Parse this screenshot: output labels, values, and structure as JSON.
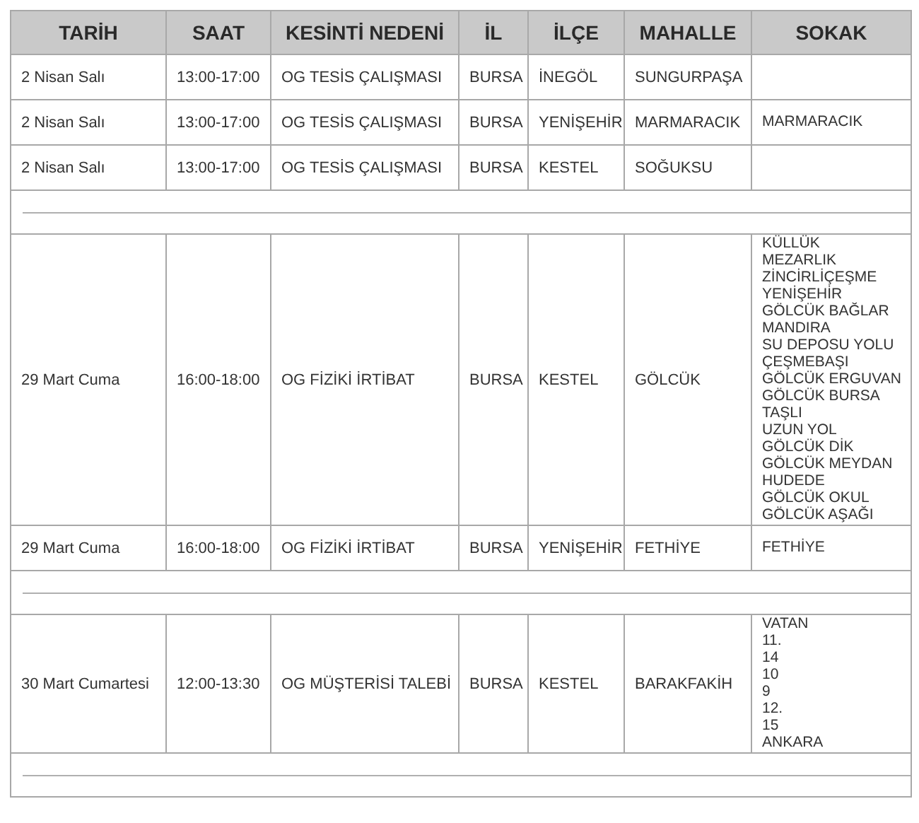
{
  "table": {
    "columns": [
      "TARİH",
      "SAAT",
      "KESİNTİ NEDENİ",
      "İL",
      "İLÇE",
      "MAHALLE",
      "SOKAK"
    ],
    "rows": [
      {
        "kind": "data",
        "cells": [
          "2 Nisan Salı",
          "13:00-17:00",
          "OG TESİS ÇALIŞMASI",
          "BURSA",
          "İNEGÖL",
          "SUNGURPAŞA"
        ],
        "streets": []
      },
      {
        "kind": "data",
        "cells": [
          "2 Nisan Salı",
          "13:00-17:00",
          "OG TESİS ÇALIŞMASI",
          "BURSA",
          "YENİŞEHİR",
          "MARMARACIK"
        ],
        "streets": [
          "MARMARACIK"
        ]
      },
      {
        "kind": "data",
        "cells": [
          "2 Nisan Salı",
          "13:00-17:00",
          "OG TESİS ÇALIŞMASI",
          "BURSA",
          "KESTEL",
          "SOĞUKSU"
        ],
        "streets": []
      },
      {
        "kind": "separator"
      },
      {
        "kind": "data",
        "cells": [
          "29 Mart Cuma",
          "16:00-18:00",
          "OG FİZİKİ İRTİBAT",
          "BURSA",
          "KESTEL",
          "GÖLCÜK"
        ],
        "streets": [
          "KÜLLÜK",
          "MEZARLIK",
          "ZİNCİRLİÇEŞME",
          "YENİŞEHİR",
          "GÖLCÜK BAĞLAR",
          "MANDIRA",
          "SU DEPOSU YOLU",
          "ÇEŞMEBAŞI",
          "GÖLCÜK ERGUVAN",
          "GÖLCÜK BURSA",
          "TAŞLI",
          "UZUN YOL",
          "GÖLCÜK DİK",
          "GÖLCÜK MEYDAN",
          "HUDEDE",
          "GÖLCÜK OKUL",
          "GÖLCÜK AŞAĞI"
        ]
      },
      {
        "kind": "data",
        "cells": [
          "29 Mart Cuma",
          "16:00-18:00",
          "OG FİZİKİ İRTİBAT",
          "BURSA",
          "YENİŞEHİR",
          "FETHİYE"
        ],
        "streets": [
          "FETHİYE"
        ]
      },
      {
        "kind": "separator"
      },
      {
        "kind": "data",
        "cells": [
          "30 Mart Cumartesi",
          "12:00-13:30",
          "OG MÜŞTERİSİ TALEBİ",
          "BURSA",
          "KESTEL",
          "BARAKFAKİH"
        ],
        "streets": [
          "VATAN",
          "11.",
          "14",
          "10",
          "9",
          "12.",
          "15",
          "ANKARA"
        ]
      },
      {
        "kind": "separator"
      }
    ]
  }
}
